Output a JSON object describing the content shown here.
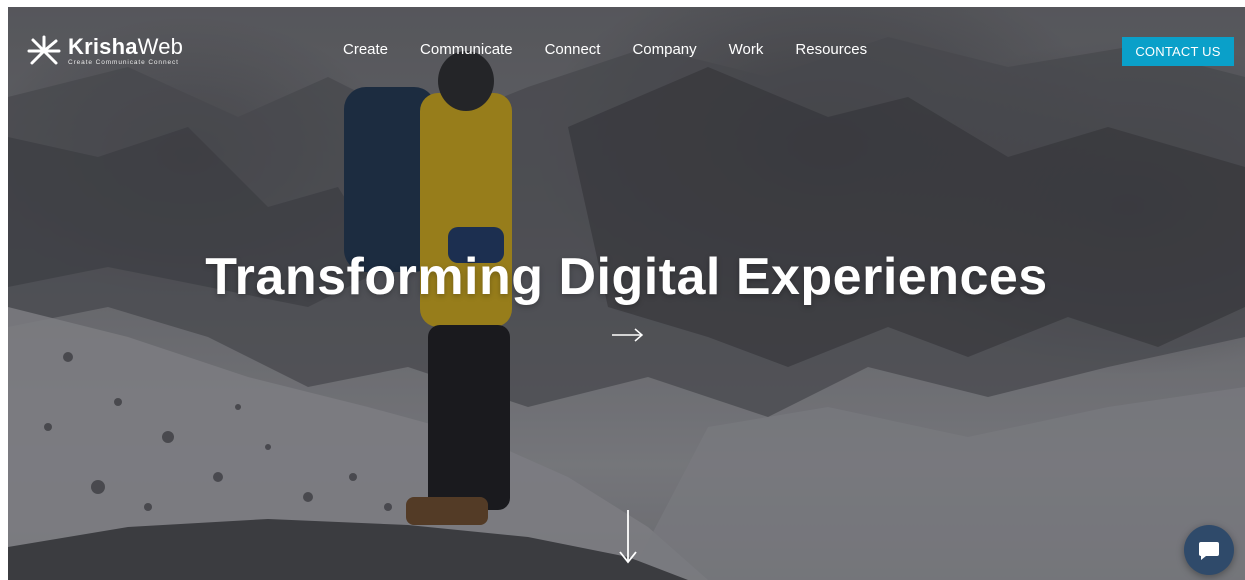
{
  "brand": {
    "name_bold": "Krisha",
    "name_regular": "Web",
    "tagline": "Create  Communicate  Connect",
    "logo_icon": "starburst-logo-icon"
  },
  "nav": {
    "items": [
      {
        "label": "Create"
      },
      {
        "label": "Communicate"
      },
      {
        "label": "Connect"
      },
      {
        "label": "Company"
      },
      {
        "label": "Work"
      },
      {
        "label": "Resources"
      }
    ]
  },
  "contact": {
    "label": "CONTACT US"
  },
  "hero": {
    "headline": "Transforming Digital Experiences",
    "cta_icon": "right-arrow-icon",
    "scroll_icon": "down-arrow-icon"
  },
  "chat": {
    "icon": "chat-bubble-icon"
  },
  "colors": {
    "accent": "#0aa0c9",
    "chat_bg": "#2f4a6a",
    "text": "#ffffff"
  }
}
